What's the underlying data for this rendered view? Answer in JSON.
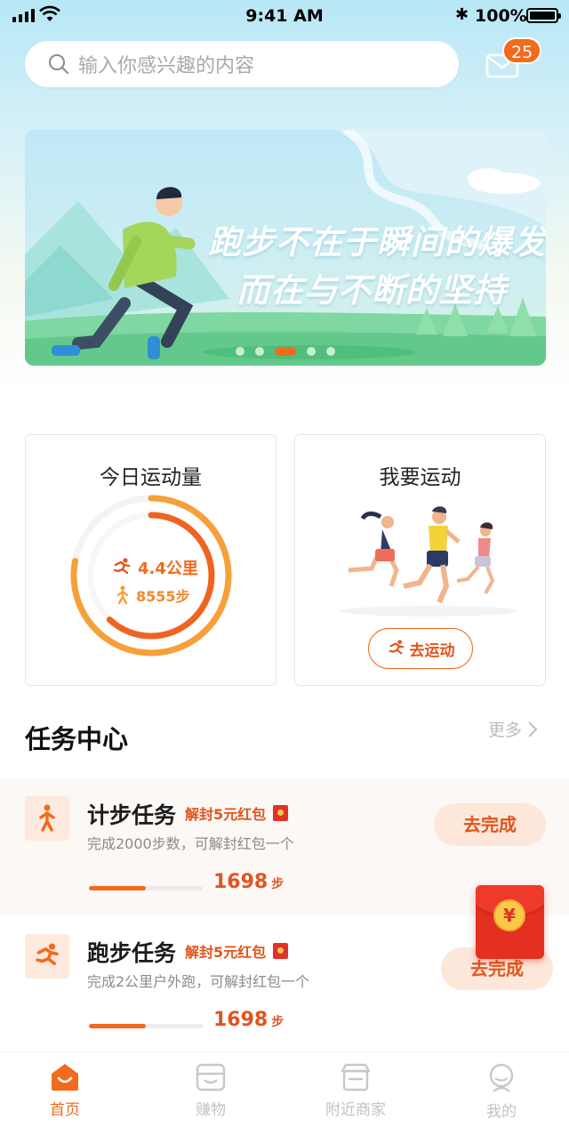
{
  "status_bar": {
    "time": "9:41 AM",
    "battery": "100%"
  },
  "search": {
    "placeholder": "输入你感兴趣的内容",
    "icon": "search-icon"
  },
  "messages": {
    "icon": "mail-icon",
    "count": "25"
  },
  "banner": {
    "line1": "跑步不在于瞬间的爆发",
    "line2": "而在与不断的坚持",
    "slides": 5,
    "active_slide": 3
  },
  "today_card": {
    "title": "今日运动量",
    "distance": "4.4公里",
    "steps": "8555步",
    "outer_ring_progress": 0.78,
    "inner_ring_progress": 0.62
  },
  "exercise_card": {
    "title": "我要运动",
    "button": "去运动"
  },
  "task_section": {
    "title": "任务中心",
    "more": "更多"
  },
  "tasks": [
    {
      "name": "计步任务",
      "reward": "解封5元红包",
      "desc": "完成2000步数，可解封红包一个",
      "progress": 0.5,
      "steps_value": "1698",
      "steps_unit": "步",
      "button": "去完成",
      "icon": "walking-icon"
    },
    {
      "name": "跑步任务",
      "reward": "解封5元红包",
      "desc": "完成2公里户外跑，可解封红包一个",
      "progress": 0.5,
      "steps_value": "1698",
      "steps_unit": "步",
      "button": "去完成",
      "icon": "running-icon"
    }
  ],
  "floating_redpack": {
    "symbol": "¥"
  },
  "tabbar": {
    "items": [
      {
        "label": "首页",
        "icon": "home-icon",
        "active": true
      },
      {
        "label": "赚物",
        "icon": "shop-icon",
        "active": false
      },
      {
        "label": "附近商家",
        "icon": "store-icon",
        "active": false
      },
      {
        "label": "我的",
        "icon": "profile-icon",
        "active": false
      }
    ]
  },
  "colors": {
    "accent": "#f26a1b",
    "accent_soft": "#fde7da",
    "ring_light": "#f7a039"
  }
}
